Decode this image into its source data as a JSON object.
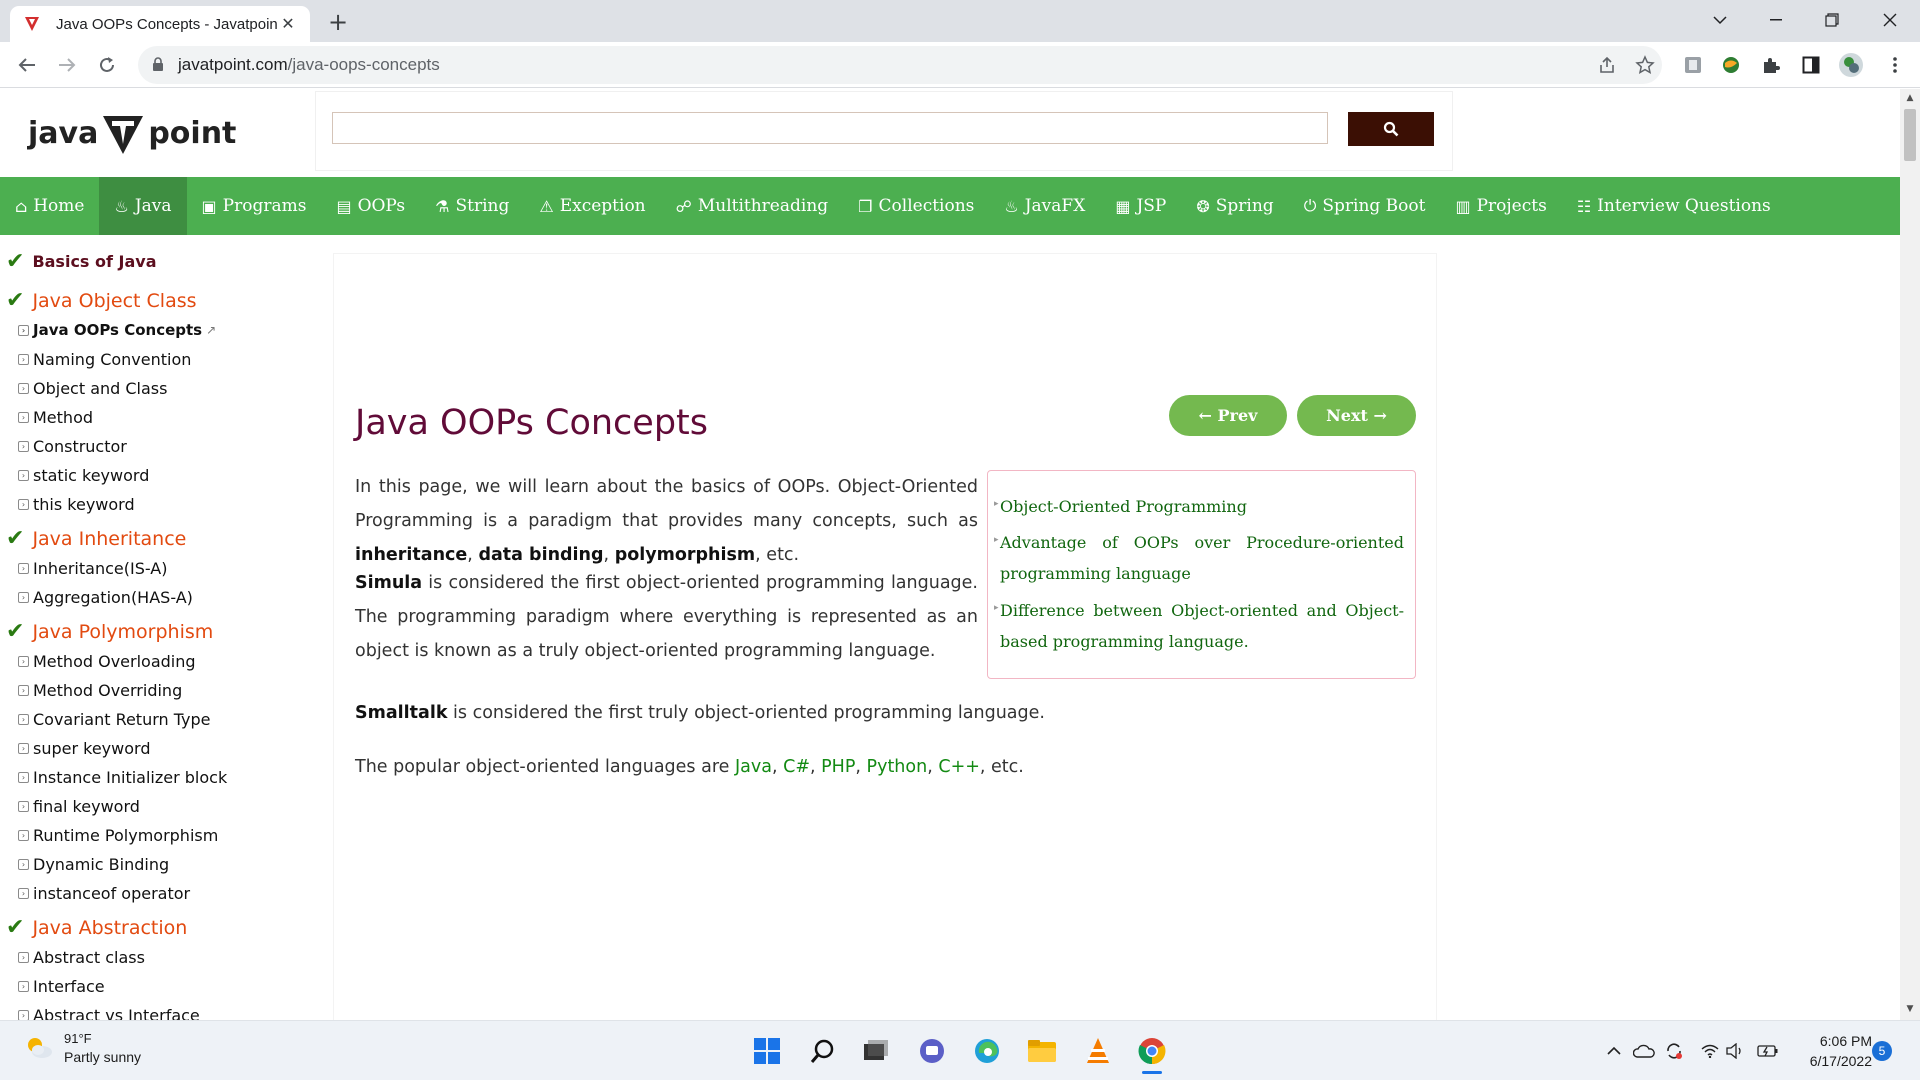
{
  "browser": {
    "tab_title": "Java OOPs Concepts - Javatpoint",
    "url_domain": "javatpoint.com",
    "url_path": "/java-oops-concepts"
  },
  "site": {
    "logo_left": "java",
    "logo_right": "point",
    "search_placeholder": "",
    "nav": [
      {
        "label": "Home",
        "icon": "home-icon"
      },
      {
        "label": "Java",
        "icon": "java-cup-icon",
        "active": true
      },
      {
        "label": "Programs",
        "icon": "monitor-icon"
      },
      {
        "label": "OOPs",
        "icon": "window-icon"
      },
      {
        "label": "String",
        "icon": "flask-icon"
      },
      {
        "label": "Exception",
        "icon": "warning-icon"
      },
      {
        "label": "Multithreading",
        "icon": "network-icon"
      },
      {
        "label": "Collections",
        "icon": "copy-icon"
      },
      {
        "label": "JavaFX",
        "icon": "java-cup-icon"
      },
      {
        "label": "JSP",
        "icon": "file-icon"
      },
      {
        "label": "Spring",
        "icon": "spring-icon"
      },
      {
        "label": "Spring Boot",
        "icon": "power-icon"
      },
      {
        "label": "Projects",
        "icon": "projects-icon"
      },
      {
        "label": "Interview Questions",
        "icon": "people-icon"
      }
    ]
  },
  "sidebar": {
    "items": [
      {
        "type": "head-small",
        "label": "Basics of Java"
      },
      {
        "type": "head",
        "label": "Java Object Class"
      },
      {
        "type": "current",
        "label": "Java OOPs Concepts"
      },
      {
        "type": "link",
        "label": "Naming Convention"
      },
      {
        "type": "link",
        "label": "Object and Class"
      },
      {
        "type": "link",
        "label": "Method"
      },
      {
        "type": "link",
        "label": "Constructor"
      },
      {
        "type": "link",
        "label": "static keyword"
      },
      {
        "type": "link",
        "label": "this keyword"
      },
      {
        "type": "head",
        "label": "Java Inheritance"
      },
      {
        "type": "link",
        "label": "Inheritance(IS-A)"
      },
      {
        "type": "link",
        "label": "Aggregation(HAS-A)"
      },
      {
        "type": "head",
        "label": "Java Polymorphism"
      },
      {
        "type": "link",
        "label": "Method Overloading"
      },
      {
        "type": "link",
        "label": "Method Overriding"
      },
      {
        "type": "link",
        "label": "Covariant Return Type"
      },
      {
        "type": "link",
        "label": "super keyword"
      },
      {
        "type": "link",
        "label": "Instance Initializer block"
      },
      {
        "type": "link",
        "label": "final keyword"
      },
      {
        "type": "link",
        "label": "Runtime Polymorphism"
      },
      {
        "type": "link",
        "label": "Dynamic Binding"
      },
      {
        "type": "link",
        "label": "instanceof operator"
      },
      {
        "type": "head",
        "label": "Java Abstraction"
      },
      {
        "type": "link",
        "label": "Abstract class"
      },
      {
        "type": "link",
        "label": "Interface"
      },
      {
        "type": "link",
        "label": "Abstract vs Interface"
      }
    ]
  },
  "main": {
    "title": "Java OOPs Concepts",
    "prev_label": "← Prev",
    "next_label": "Next →",
    "p1_a": "In this page, we will learn about the basics of OOPs. Object-Oriented Programming is a paradigm that provides many concepts, such as ",
    "p1_b1": "inheritance",
    "p1_sep1": ", ",
    "p1_b2": "data binding",
    "p1_sep2": ", ",
    "p1_b3": "polymorphism",
    "p1_end": ", etc.",
    "p2_b": "Simula",
    "p2_rest": " is considered the first object-oriented programming language. The programming paradigm where everything is represented as an object is known as a truly object-oriented programming language.",
    "p3_b": "Smalltalk",
    "p3_rest": " is considered the first truly object-oriented programming language.",
    "p4_a": "The popular object-oriented languages are ",
    "p4_langs": [
      "Java",
      "C#",
      "PHP",
      "Python",
      "C++"
    ],
    "p4_sep": ", ",
    "p4_end": ", etc.",
    "toc": [
      "Object-Oriented Programming",
      "Advantage of OOPs over Procedure-oriented programming language",
      "Difference between Object-oriented and Object-based programming language."
    ]
  },
  "taskbar": {
    "temp": "91°F",
    "weather": "Partly sunny",
    "time": "6:06 PM",
    "date": "6/17/2022",
    "notifications": "5"
  },
  "colors": {
    "nav_green": "#4caf50",
    "title_maroon": "#610b38",
    "link_green": "#138a13",
    "search_btn": "#3b0f04"
  }
}
